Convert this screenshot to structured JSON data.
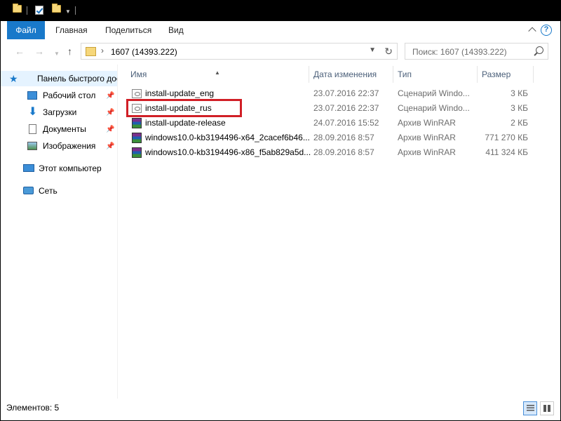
{
  "ribbon": {
    "tabs": [
      {
        "label": "Файл"
      },
      {
        "label": "Главная"
      },
      {
        "label": "Поделиться"
      },
      {
        "label": "Вид"
      }
    ],
    "help_label": "?"
  },
  "address": {
    "separator": "›",
    "path": "1607 (14393.222)"
  },
  "search": {
    "placeholder": "Поиск: 1607 (14393.222)"
  },
  "nav": {
    "quick_access": "Панель быстрого доступа",
    "items": [
      {
        "label": "Рабочий стол",
        "icon": "desktop-icon"
      },
      {
        "label": "Загрузки",
        "icon": "downloads-icon"
      },
      {
        "label": "Документы",
        "icon": "documents-icon"
      },
      {
        "label": "Изображения",
        "icon": "pictures-icon"
      }
    ],
    "this_pc": "Этот компьютер",
    "network": "Сеть"
  },
  "columns": {
    "name": "Имя",
    "date": "Дата изменения",
    "type": "Тип",
    "size": "Размер"
  },
  "files": [
    {
      "name": "install-update_eng",
      "date": "23.07.2016 22:37",
      "type": "Сценарий Windo...",
      "size": "3 КБ",
      "icon": "script-file-icon"
    },
    {
      "name": "install-update_rus",
      "date": "23.07.2016 22:37",
      "type": "Сценарий Windo...",
      "size": "3 КБ",
      "icon": "script-file-icon"
    },
    {
      "name": "install-update-release",
      "date": "24.07.2016 15:52",
      "type": "Архив WinRAR",
      "size": "2 КБ",
      "icon": "winrar-archive-icon"
    },
    {
      "name": "windows10.0-kb3194496-x64_2cacef6b46...",
      "date": "28.09.2016 8:57",
      "type": "Архив WinRAR",
      "size": "771 270 КБ",
      "icon": "winrar-archive-icon"
    },
    {
      "name": "windows10.0-kb3194496-x86_f5ab829a5d...",
      "date": "28.09.2016 8:57",
      "type": "Архив WinRAR",
      "size": "411 324 КБ",
      "icon": "winrar-archive-icon"
    }
  ],
  "status": {
    "items_count": "Элементов: 5"
  },
  "colors": {
    "accent": "#1979ca",
    "highlight_box": "#d11f26",
    "selected_nav": "#e5f3ff"
  }
}
